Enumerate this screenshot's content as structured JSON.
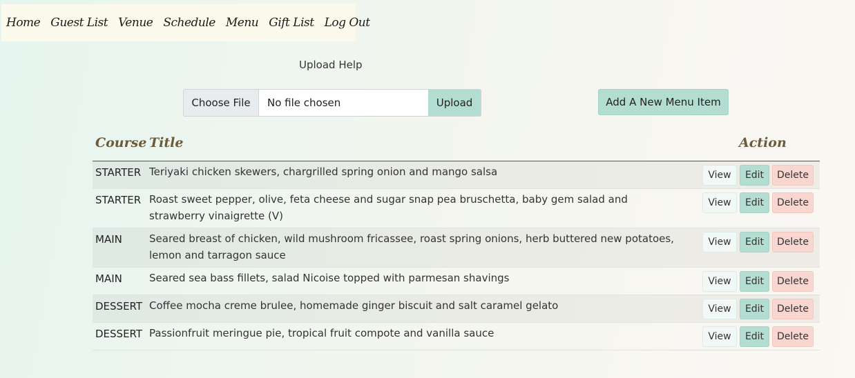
{
  "nav": {
    "items": [
      "Home",
      "Guest List",
      "Venue",
      "Schedule",
      "Menu",
      "Gift List",
      "Log Out"
    ]
  },
  "upload": {
    "help_label": "Upload Help",
    "choose_label": "Choose File",
    "no_file_label": "No file chosen",
    "upload_label": "Upload"
  },
  "add_button_label": "Add A New Menu Item",
  "table": {
    "headers": {
      "course": "Course",
      "title": "Title",
      "action": "Action"
    },
    "rows": [
      {
        "course": "STARTER",
        "title": "Teriyaki chicken skewers, chargrilled spring onion and mango salsa"
      },
      {
        "course": "STARTER",
        "title": "Roast sweet pepper, olive, feta cheese and sugar snap pea bruschetta, baby gem salad and strawberry vinaigrette (V)"
      },
      {
        "course": "MAIN",
        "title": "Seared breast of chicken, wild mushroom fricassee, roast spring onions, herb buttered new potatoes, lemon and tarragon sauce"
      },
      {
        "course": "MAIN",
        "title": "Seared sea bass fillets, salad Nicoise topped with parmesan shavings"
      },
      {
        "course": "DESSERT",
        "title": "Coffee mocha creme brulee, homemade ginger biscuit and salt caramel gelato"
      },
      {
        "course": "DESSERT",
        "title": "Passionfruit meringue pie, tropical fruit compote and vanilla sauce"
      }
    ],
    "action_labels": {
      "view": "View",
      "edit": "Edit",
      "delete": "Delete"
    }
  },
  "colors": {
    "accent": "#b3ddd1",
    "danger_soft": "#f9d7d0",
    "heading": "#6b5a3b"
  }
}
